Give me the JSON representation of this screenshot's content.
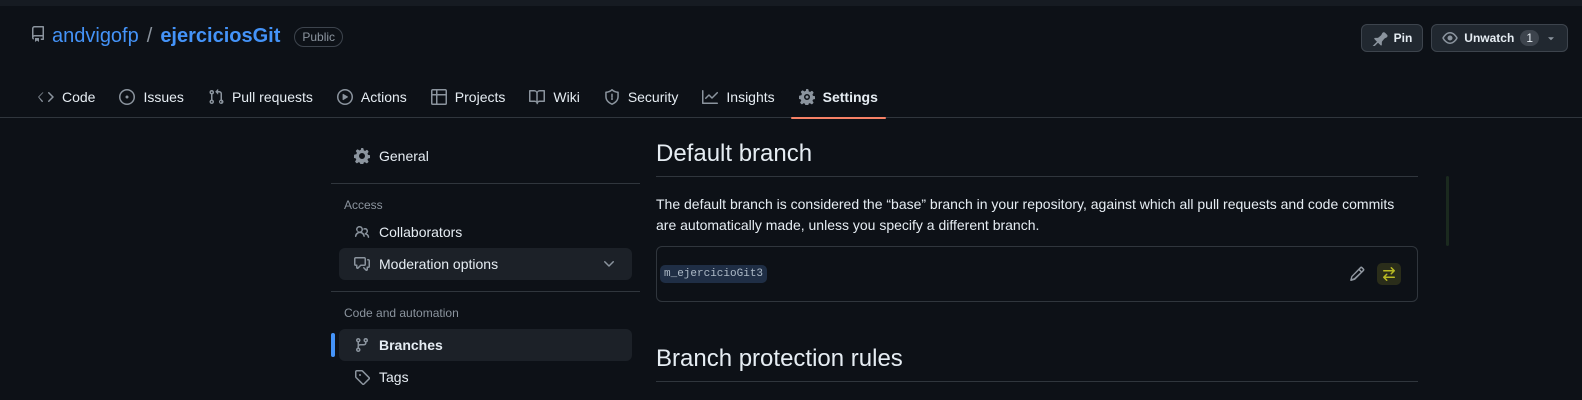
{
  "repo": {
    "owner": "andvigofp",
    "separator": "/",
    "name": "ejerciciosGit",
    "visibility": "Public"
  },
  "header_actions": {
    "pin_label": "Pin",
    "unwatch_label": "Unwatch",
    "watch_count": "1"
  },
  "tabs": [
    {
      "label": "Code",
      "icon": "code-icon"
    },
    {
      "label": "Issues",
      "icon": "issue-icon"
    },
    {
      "label": "Pull requests",
      "icon": "pull-request-icon"
    },
    {
      "label": "Actions",
      "icon": "play-icon"
    },
    {
      "label": "Projects",
      "icon": "table-icon"
    },
    {
      "label": "Wiki",
      "icon": "book-icon"
    },
    {
      "label": "Security",
      "icon": "shield-icon"
    },
    {
      "label": "Insights",
      "icon": "graph-icon"
    },
    {
      "label": "Settings",
      "icon": "gear-icon",
      "active": true
    }
  ],
  "sidebar": {
    "general": "General",
    "access_heading": "Access",
    "collaborators": "Collaborators",
    "moderation": "Moderation options",
    "code_heading": "Code and automation",
    "branches": "Branches",
    "tags": "Tags"
  },
  "main": {
    "default_branch_title": "Default branch",
    "default_branch_desc": "The default branch is considered the “base” branch in your repository, against which all pull requests and code commits are automatically made, unless you specify a different branch.",
    "branch_name": "m_ejercicioGit3",
    "protection_title": "Branch protection rules"
  },
  "colors": {
    "accent_link": "#4493f8",
    "active_tab_underline": "#f78166",
    "background": "#0d1117"
  }
}
